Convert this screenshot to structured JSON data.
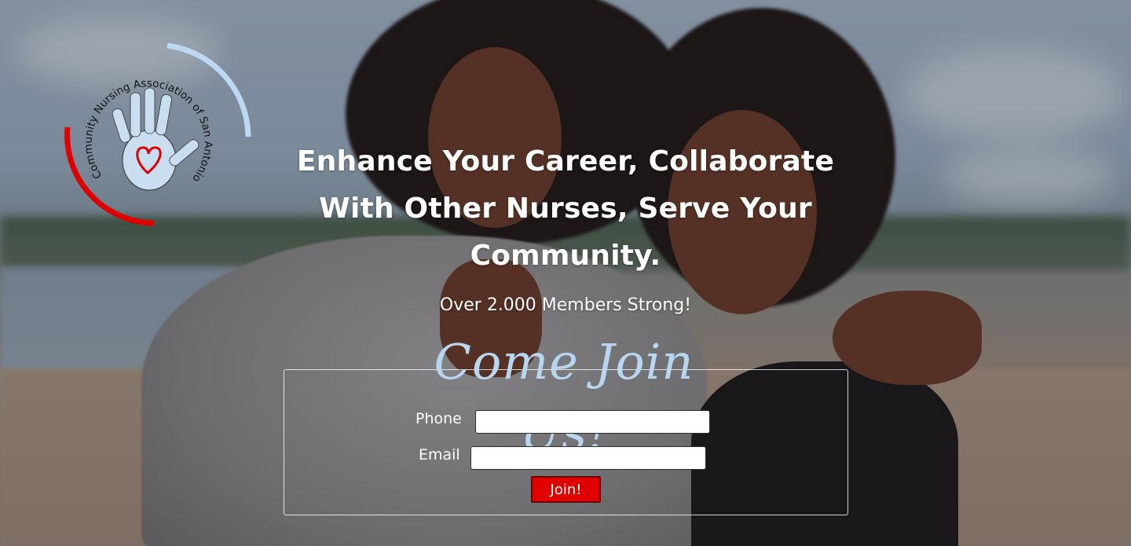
{
  "logo": {
    "name": "Community Nursing Association of San Antonio",
    "icon": "handprint-heart-icon",
    "colors": {
      "arc_blue": "#bcd8f2",
      "arc_red": "#e10000",
      "hand": "#c9def0"
    }
  },
  "hero": {
    "headline_line1": "Enhance Your Career, Collaborate",
    "headline_line2": "With Other Nurses, Serve Your",
    "headline_line3": "Community.",
    "subline": "Over 2.000 Members Strong!"
  },
  "form": {
    "title": "Come Join Us!",
    "phone_label": "Phone",
    "phone_value": "",
    "email_label": "Email",
    "email_value": "",
    "submit_label": "Join!"
  },
  "colors": {
    "accent_red": "#e10000",
    "script_blue": "#b8d6f0",
    "text": "#ffffff"
  }
}
